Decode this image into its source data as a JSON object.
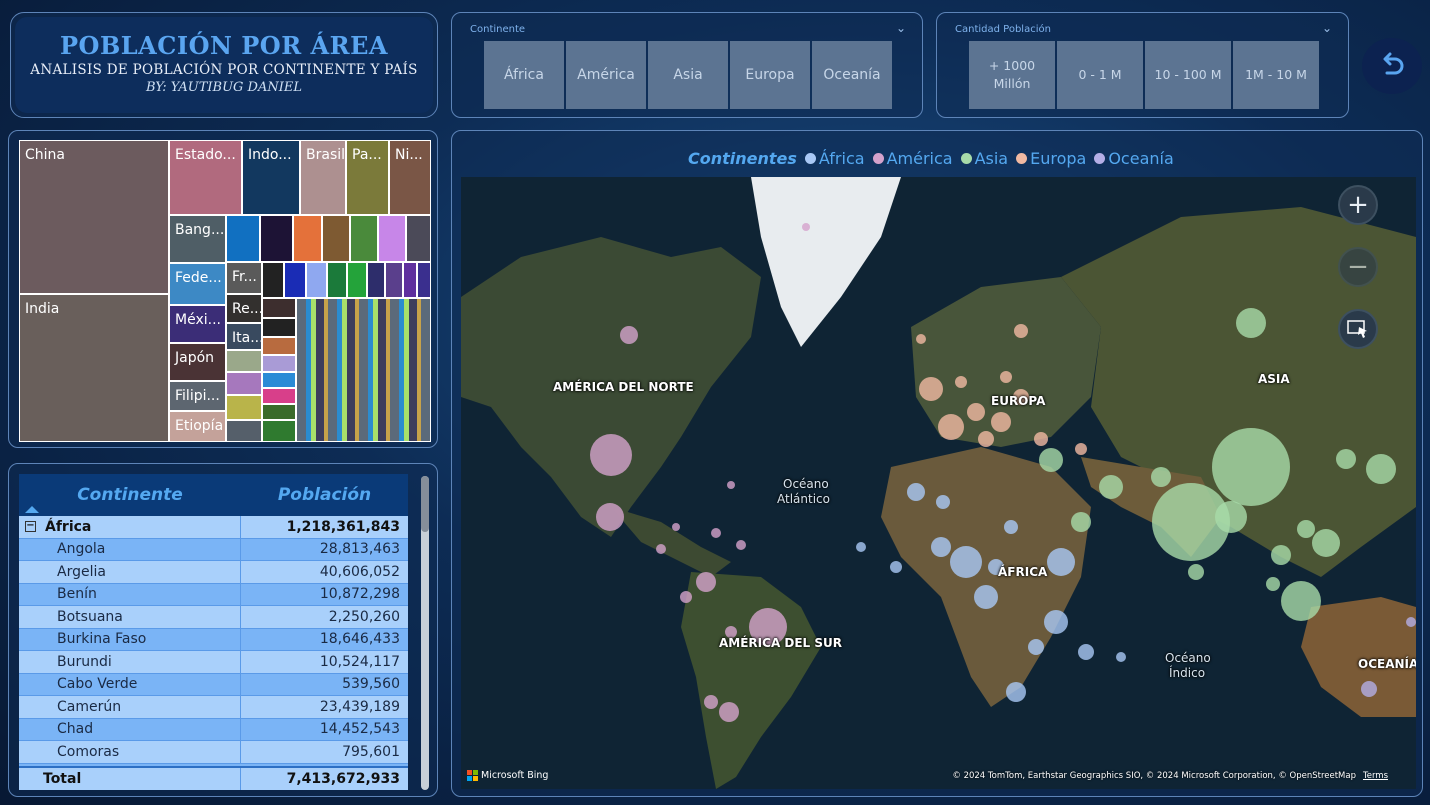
{
  "header": {
    "title": "POBLACIÓN POR ÁREA",
    "subtitle": "ANALISIS DE POBLACIÓN POR CONTINENTE Y PAÍS",
    "byline": "BY: YAUTIBUG DANIEL"
  },
  "slicer_continent": {
    "label": "Continente",
    "options": [
      "África",
      "América",
      "Asia",
      "Europa",
      "Oceanía"
    ]
  },
  "slicer_population": {
    "label": "Cantidad Población",
    "options": [
      "+ 1000 Millón",
      "0 - 1 M",
      "10 - 100 M",
      "1M - 10 M"
    ]
  },
  "back_button": {
    "icon": "undo-arrow-icon"
  },
  "treemap": {
    "labels": {
      "china": "China",
      "india": "India",
      "usa": "Estado...",
      "indonesia": "Indo...",
      "brasil": "Brasil",
      "pakistan": "Pa...",
      "nigeria": "Ni...",
      "bangladesh": "Bang...",
      "rusia": "Fede...",
      "mexico": "Méxi...",
      "japon": "Japón",
      "filipinas": "Filipi...",
      "etiopia": "Etiopía",
      "francia": "Fr...",
      "reino_unido": "Re...",
      "italia": "Ita..."
    }
  },
  "table": {
    "headers": {
      "continent": "Continente",
      "population": "Población"
    },
    "group": {
      "name": "África",
      "value": "1,218,361,843"
    },
    "rows": [
      {
        "name": "Angola",
        "value": "28,813,463"
      },
      {
        "name": "Argelia",
        "value": "40,606,052"
      },
      {
        "name": "Benín",
        "value": "10,872,298"
      },
      {
        "name": "Botsuana",
        "value": "2,250,260"
      },
      {
        "name": "Burkina Faso",
        "value": "18,646,433"
      },
      {
        "name": "Burundi",
        "value": "10,524,117"
      },
      {
        "name": "Cabo Verde",
        "value": "539,560"
      },
      {
        "name": "Camerún",
        "value": "23,439,189"
      },
      {
        "name": "Chad",
        "value": "14,452,543"
      },
      {
        "name": "Comoras",
        "value": "795,601"
      }
    ],
    "total": {
      "label": "Total",
      "value": "7,413,672,933"
    }
  },
  "map": {
    "legend_title": "Continentes",
    "legend": [
      {
        "name": "África",
        "color": "#a9c8f5"
      },
      {
        "name": "América",
        "color": "#d4a2cc"
      },
      {
        "name": "Asia",
        "color": "#a7dba9"
      },
      {
        "name": "Europa",
        "color": "#f1b9a2"
      },
      {
        "name": "Oceanía",
        "color": "#b4aee6"
      }
    ],
    "region_labels": {
      "north_america": "AMÉRICA DEL NORTE",
      "south_america": "AMÉRICA DEL SUR",
      "europe": "EUROPA",
      "asia": "ASIA",
      "africa": "ÁFRICA",
      "oceania": "OCEANÍA",
      "atlantic_1": "Océano",
      "atlantic_2": "Atlántico",
      "indian_1": "Océano",
      "indian_2": "Índico"
    },
    "provider": "Microsoft Bing",
    "attribution": "© 2024 TomTom, Earthstar Geographics SIO, © 2024 Microsoft Corporation, © OpenStreetMap",
    "terms": "Terms"
  }
}
